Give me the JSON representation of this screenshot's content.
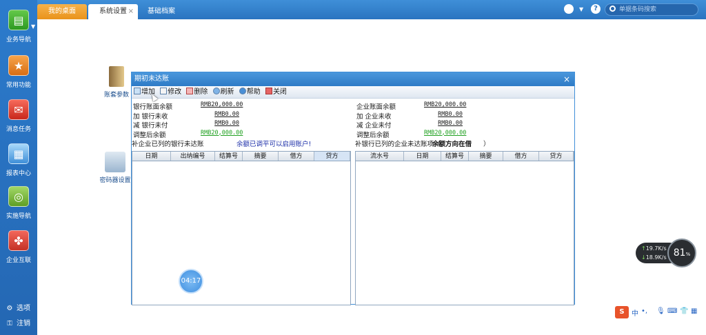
{
  "tabs": [
    {
      "label": "我的桌面",
      "active": false
    },
    {
      "label": "系统设置",
      "active": true,
      "close": "×"
    },
    {
      "label": "基础档案",
      "active": false
    }
  ],
  "header": {
    "help_icon": "?",
    "search_placeholder": "单据条码搜索"
  },
  "sidebar": {
    "items": [
      {
        "label": "业务导航",
        "icon": "flowchart-icon"
      },
      {
        "label": "常用功能",
        "icon": "star-icon"
      },
      {
        "label": "消息任务",
        "icon": "mail-icon"
      },
      {
        "label": "报表中心",
        "icon": "report-icon"
      },
      {
        "label": "实施导航",
        "icon": "compass-icon"
      },
      {
        "label": "企业互联",
        "icon": "connect-icon"
      }
    ],
    "bottom": [
      {
        "label": "选项",
        "icon": "gear-icon"
      },
      {
        "label": "注销",
        "icon": "key-icon"
      }
    ]
  },
  "desktop": {
    "shortcuts": [
      {
        "label": "账套参数"
      },
      {
        "label": "密码器设置"
      }
    ]
  },
  "dialog": {
    "title": "期初未达账",
    "close": "×",
    "toolbar": [
      {
        "label": "增加",
        "icon": "add-icon"
      },
      {
        "label": "修改",
        "icon": "edit-icon"
      },
      {
        "label": "删除",
        "icon": "delete-icon"
      },
      {
        "label": "刷新",
        "icon": "refresh-icon"
      },
      {
        "label": "帮助",
        "icon": "help-icon"
      },
      {
        "label": "关闭",
        "icon": "close-icon"
      }
    ],
    "left": {
      "rows": [
        {
          "label": "银行账面余额",
          "value": "RMB20,000.00",
          "color": "#1a1a1a"
        },
        {
          "label": "加 银行未收",
          "value": "RMB0.00",
          "color": "#1a1a1a"
        },
        {
          "label": "减 银行未付",
          "value": "RMB0.00",
          "color": "#1a1a1a"
        },
        {
          "label": "调整后余额",
          "value": "RMB20,000.00",
          "color": "#1fa01f"
        }
      ],
      "note_a": "补企业已列的银行未达账",
      "note_b": "余额已调平可以启用账户!",
      "columns": [
        "日期",
        "出纳编号",
        "结算号",
        "摘要",
        "借方",
        "贷方"
      ]
    },
    "right": {
      "rows": [
        {
          "label": "企业账面余额",
          "value": "RMB20,000.00",
          "color": "#1a1a1a"
        },
        {
          "label": "加 企业未收",
          "value": "RMB0.00",
          "color": "#1a1a1a"
        },
        {
          "label": "减 企业未付",
          "value": "RMB0.00",
          "color": "#1a1a1a"
        },
        {
          "label": "调整后余额",
          "value": "RMB20,000.00",
          "color": "#1fa01f"
        }
      ],
      "note_a": "补银行已列的企业未达账项（",
      "note_b": "余额方向在借",
      "note_c": "）",
      "columns": [
        "流水号",
        "日期",
        "结算号",
        "摘要",
        "借方",
        "贷方"
      ]
    }
  },
  "timer": "04:17",
  "net": {
    "up": "19.7",
    "up_unit": "K/s",
    "down": "18.9",
    "down_unit": "K/s",
    "percent": "81",
    "percent_unit": "%"
  },
  "ime": {
    "logo": "S",
    "mode": "中"
  }
}
